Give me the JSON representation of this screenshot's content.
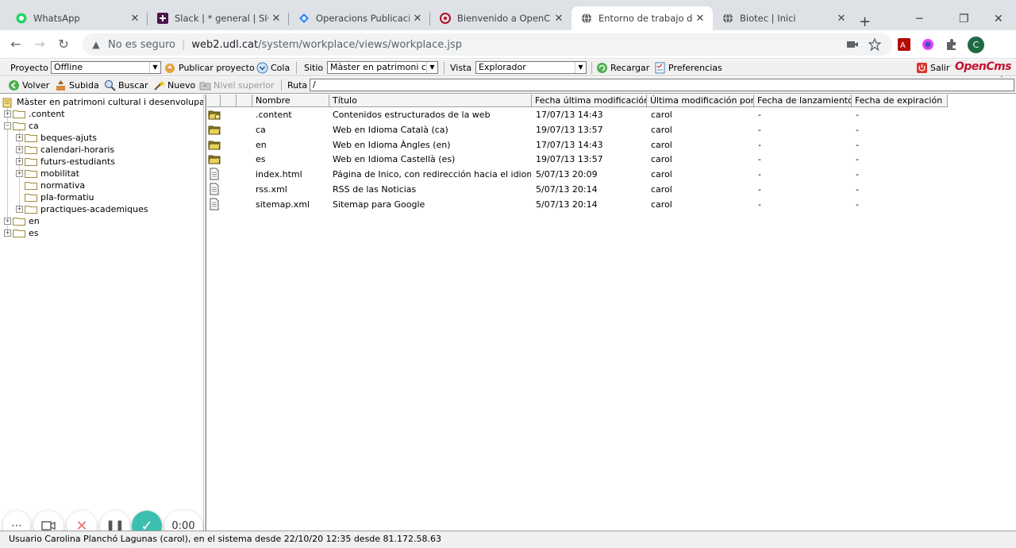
{
  "browser": {
    "tabs": [
      {
        "title": "WhatsApp",
        "icon": "whatsapp-icon"
      },
      {
        "title": "Slack | * general | SIC UdL",
        "icon": "slack-icon"
      },
      {
        "title": "Operacions Publicació Web",
        "icon": "jira-icon"
      },
      {
        "title": "Bienvenido a OpenCms",
        "icon": "opencms-icon"
      },
      {
        "title": "Entorno de trabajo de OpenCms",
        "icon": "globe-icon"
      },
      {
        "title": "Biotec | Inici",
        "icon": "globe-icon"
      }
    ],
    "security_label": "No es seguro",
    "url_host": "web2.udl.cat",
    "url_path": "/system/workplace/views/workplace.jsp",
    "avatar_letter": "C"
  },
  "toolbar": {
    "project_label": "Proyecto",
    "project_value": "Offline",
    "publish_label": "Publicar proyecto",
    "queue_label": "Cola",
    "site_label": "Sitio",
    "site_value": "Màster en patrimoni cu",
    "view_label": "Vista",
    "view_value": "Explorador",
    "reload_label": "Recargar",
    "prefs_label": "Preferencias",
    "exit_label": "Salir",
    "logo_text": "OpenCms",
    "back_label": "Volver",
    "upload_label": "Subida",
    "search_label": "Buscar",
    "new_label": "Nuevo",
    "parent_label": "Nivel superior",
    "path_label": "Ruta",
    "path_value": "/"
  },
  "tree": {
    "root": "Màster en patrimoni cultural i desenvolupame",
    "nodes": [
      {
        "label": ".content"
      },
      {
        "label": "ca"
      },
      {
        "label": "beques-ajuts"
      },
      {
        "label": "calendari-horaris"
      },
      {
        "label": "futurs-estudiants"
      },
      {
        "label": "mobilitat"
      },
      {
        "label": "normativa"
      },
      {
        "label": "pla-formatiu"
      },
      {
        "label": "practiques-academiques"
      },
      {
        "label": "en"
      },
      {
        "label": "es"
      }
    ]
  },
  "files": {
    "headers": [
      "Nombre",
      "Título",
      "Fecha última modificación",
      "Última modificación por",
      "Fecha de lanzamiento",
      "Fecha de expiración"
    ],
    "rows": [
      {
        "type": "folder",
        "name": ".content",
        "title": "Contenidos estructurados de la web",
        "modified": "17/07/13 14:43",
        "by": "carol",
        "release": "-",
        "expiry": "-"
      },
      {
        "type": "folder",
        "name": "ca",
        "title": "Web en Idioma Català (ca)",
        "modified": "19/07/13 13:57",
        "by": "carol",
        "release": "-",
        "expiry": "-"
      },
      {
        "type": "folder",
        "name": "en",
        "title": "Web en Idioma Àngles (en)",
        "modified": "17/07/13 14:43",
        "by": "carol",
        "release": "-",
        "expiry": "-"
      },
      {
        "type": "folder",
        "name": "es",
        "title": "Web en Idioma Castellà (es)",
        "modified": "19/07/13 13:57",
        "by": "carol",
        "release": "-",
        "expiry": "-"
      },
      {
        "type": "file",
        "name": "index.html",
        "title": "Página de Inico, con redirección hacia el idioma",
        "modified": "5/07/13 20:09",
        "by": "carol",
        "release": "-",
        "expiry": "-"
      },
      {
        "type": "file",
        "name": "rss.xml",
        "title": "RSS de las Noticias",
        "modified": "5/07/13 20:14",
        "by": "carol",
        "release": "-",
        "expiry": "-"
      },
      {
        "type": "file",
        "name": "sitemap.xml",
        "title": "Sitemap para Google",
        "modified": "5/07/13 20:14",
        "by": "carol",
        "release": "-",
        "expiry": "-"
      }
    ]
  },
  "status": {
    "text": "Usuario Carolina Planchó Lagunas (carol), en el sistema desde 22/10/20 12:35 desde 81.172.58.63"
  },
  "recorder": {
    "timer": "0:00"
  }
}
